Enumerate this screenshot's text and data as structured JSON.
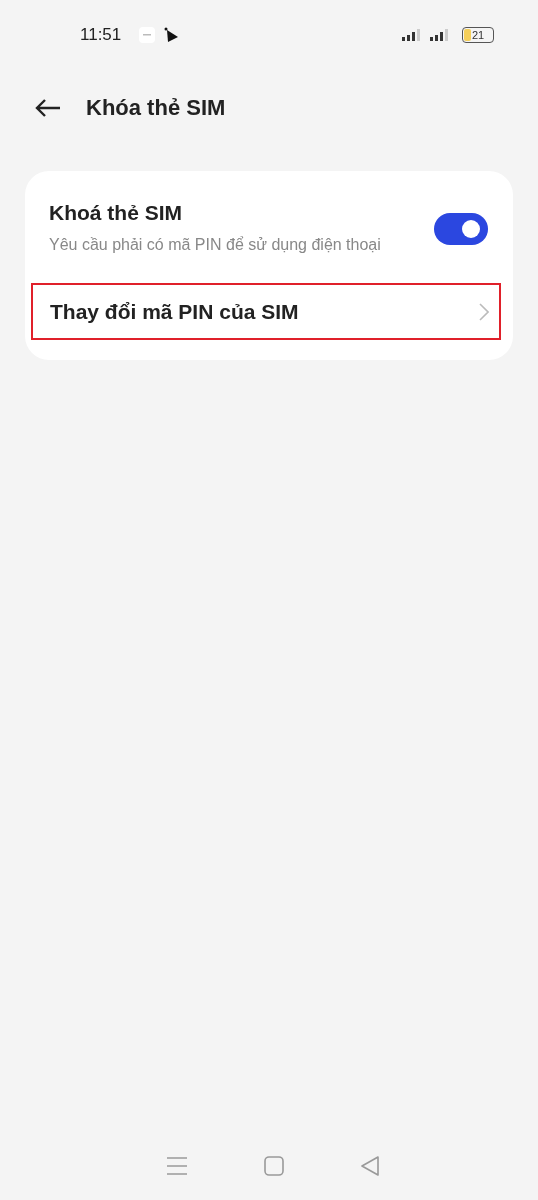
{
  "status_bar": {
    "time": "11:51",
    "battery": "21"
  },
  "header": {
    "title": "Khóa thẻ SIM"
  },
  "settings": [
    {
      "kind": "toggle",
      "title": "Khoá thẻ SIM",
      "subtitle": "Yêu cầu phải có mã PIN để sử dụng điện thoại",
      "on": true,
      "highlighted": false
    },
    {
      "kind": "link",
      "title": "Thay đổi mã PIN của SIM",
      "highlighted": true
    }
  ]
}
